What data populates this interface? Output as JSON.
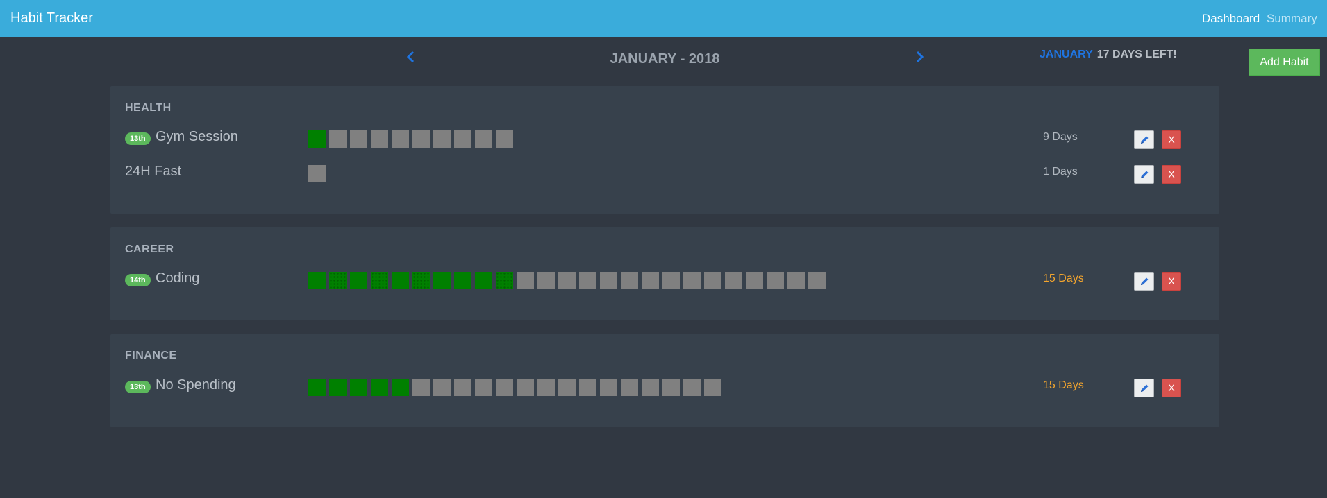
{
  "navbar": {
    "brand": "Habit Tracker",
    "links": {
      "dashboard": "Dashboard",
      "summary": "Summary"
    }
  },
  "calendar": {
    "title": "JANUARY - 2018",
    "status_month": "JANUARY",
    "status_days_left": "17 DAYS LEFT!",
    "prev_icon": "chevron-left-icon",
    "next_icon": "chevron-right-icon"
  },
  "add_habit_label": "Add Habit",
  "colors": {
    "navbar": "#3aacdb",
    "background": "#313842",
    "panel": "#37414c",
    "completed_day": "#008000",
    "pending_day": "#808080",
    "badge": "#5cb85c",
    "warning_days": "#f3a52e",
    "delete": "#d9534f"
  },
  "categories": [
    {
      "title": "HEALTH",
      "habits": [
        {
          "badge": "13th",
          "name": "Gym Session",
          "days": "9 Days",
          "completed": 1,
          "total": 10,
          "dotted": []
        },
        {
          "badge": "",
          "name": "24H Fast",
          "days": "1 Days",
          "completed": 0,
          "total": 1,
          "dotted": []
        }
      ]
    },
    {
      "title": "CAREER",
      "habits": [
        {
          "badge": "14th",
          "name": "Coding",
          "days": "15 Days",
          "completed": 10,
          "total": 25,
          "dotted": [
            2,
            4,
            6,
            10
          ]
        }
      ]
    },
    {
      "title": "FINANCE",
      "habits": [
        {
          "badge": "13th",
          "name": "No Spending",
          "days": "15 Days",
          "completed": 5,
          "total": 20,
          "dotted": []
        }
      ]
    }
  ],
  "delete_label": "X",
  "edit_icon": "pencil-icon"
}
